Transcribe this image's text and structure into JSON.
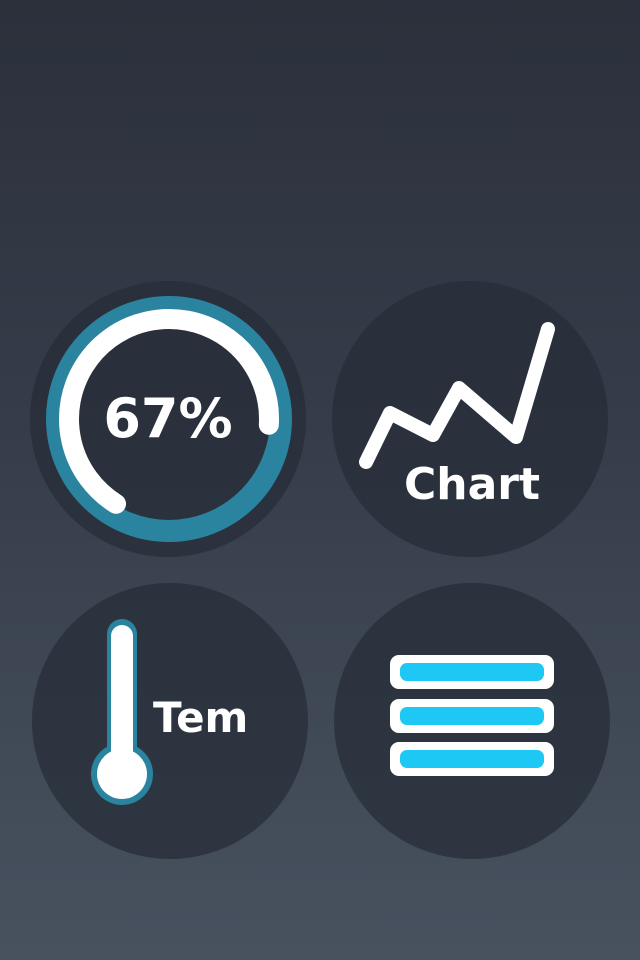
{
  "tiles": {
    "progress": {
      "value_text": "67%",
      "percent": 67
    },
    "chart": {
      "label": "Chart"
    },
    "temperature": {
      "label": "Tem"
    },
    "menu": {
      "rows": 3
    }
  },
  "colors": {
    "ring_track": "#2a84a0",
    "ring_fill": "#ffffff",
    "thermo_outline": "#2a84a0",
    "menu_bar": "#1ec8f5",
    "menu_frame": "#ffffff",
    "tile_bg": "#262c38"
  },
  "icons": {
    "progress": "progress-ring-icon",
    "chart": "line-chart-icon",
    "temperature": "thermometer-icon",
    "menu": "hamburger-list-icon"
  }
}
